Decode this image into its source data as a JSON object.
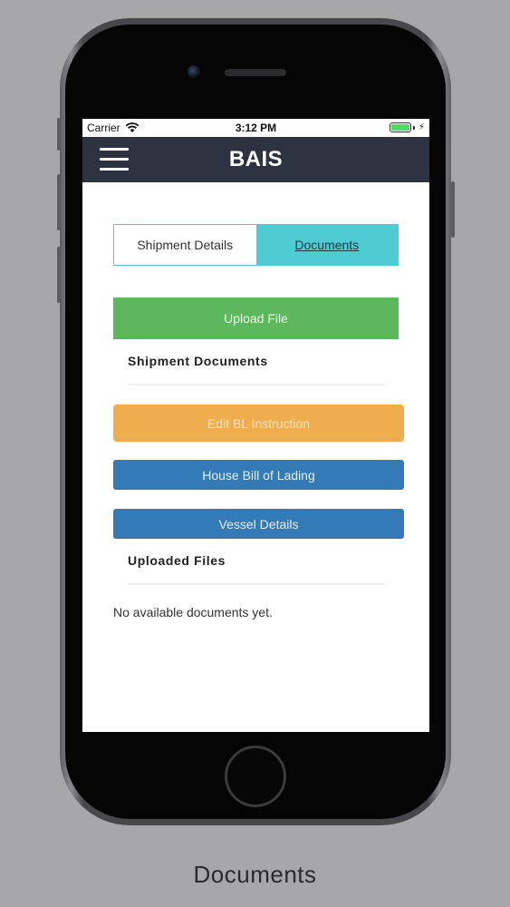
{
  "status_bar": {
    "carrier": "Carrier",
    "time": "3:12 PM"
  },
  "header": {
    "title": "BAIS"
  },
  "tabs": [
    {
      "label": "Shipment Details"
    },
    {
      "label": "Documents"
    }
  ],
  "actions": {
    "upload": "Upload File",
    "edit_bl": "Edit BL Instruction",
    "house_bl": "House Bill of Lading",
    "vessel": "Vessel Details"
  },
  "sections": {
    "shipment_documents": "Shipment Documents",
    "uploaded_files": "Uploaded Files"
  },
  "empty_message": "No available documents yet.",
  "caption": "Documents",
  "colors": {
    "header_bg": "#2d3240",
    "tab_active": "#4ecbd3",
    "upload": "#5cb85c",
    "edit_bl": "#f0ad4e",
    "primary": "#337ab7",
    "background": "#a7a6a9"
  },
  "icons": {
    "menu": "hamburger-menu-icon",
    "wifi": "wifi-icon",
    "battery": "battery-icon",
    "charging": "charging-bolt-icon"
  }
}
